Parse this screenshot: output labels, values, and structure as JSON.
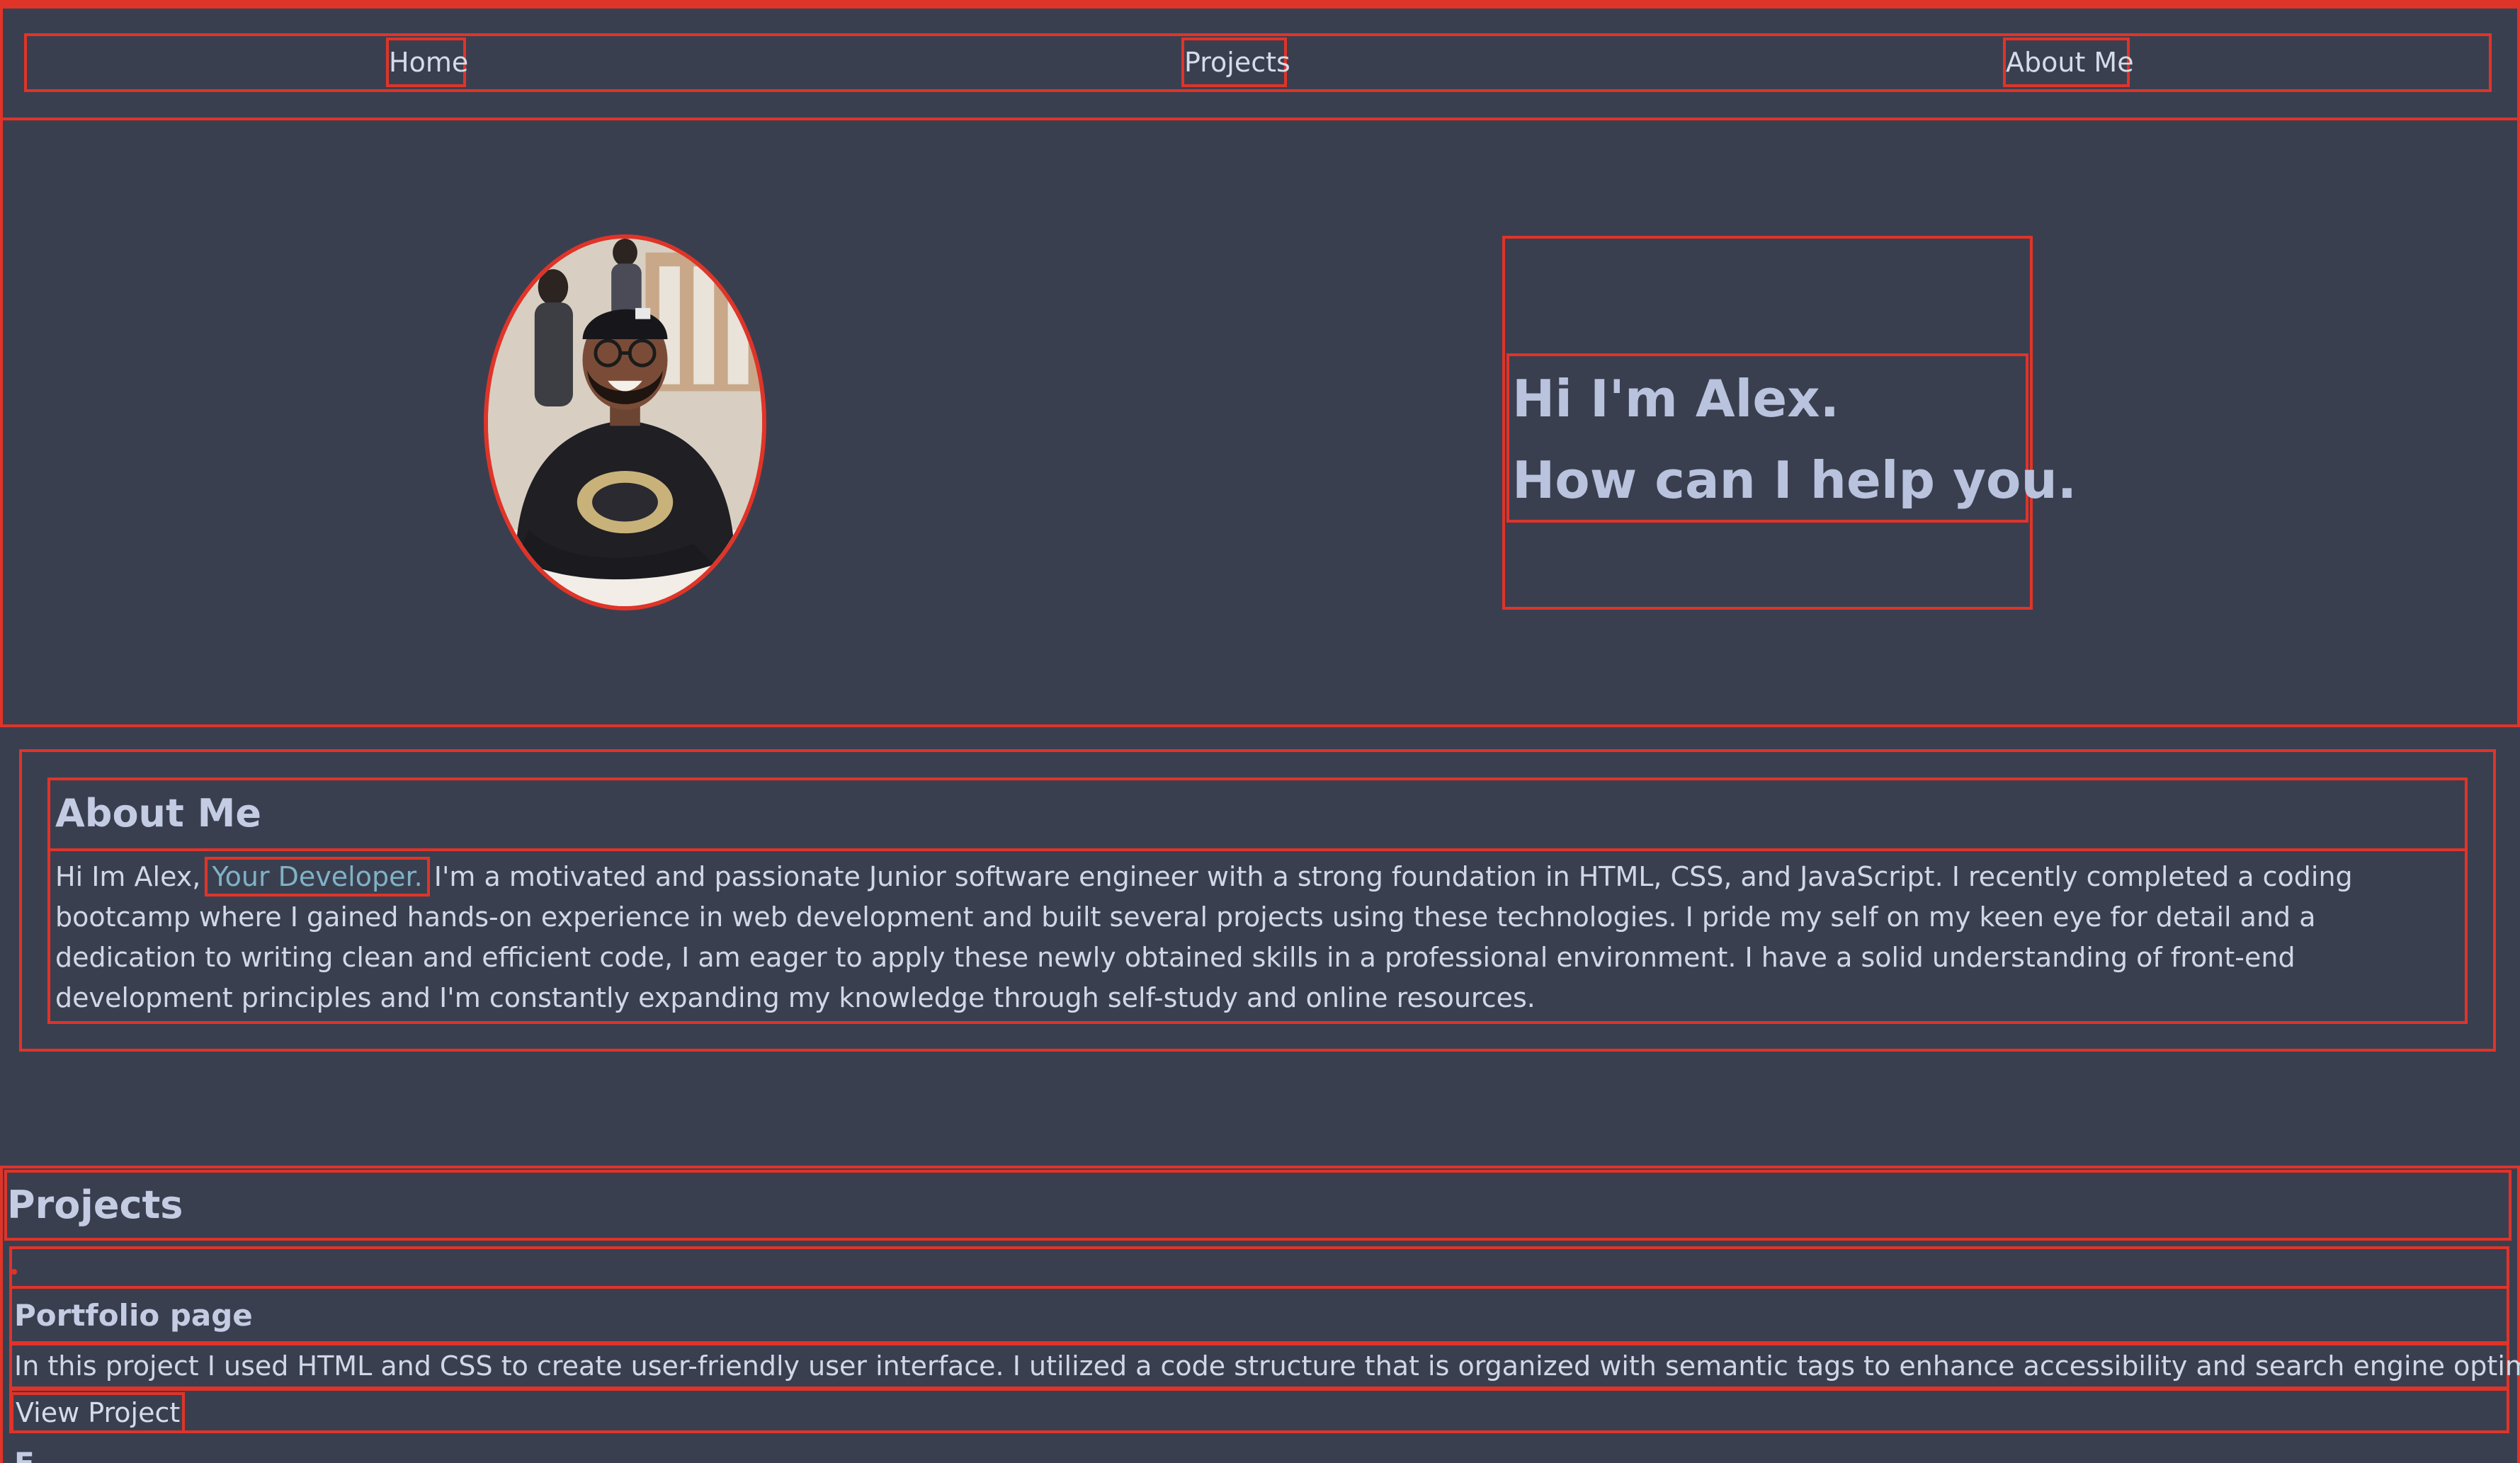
{
  "nav": {
    "items": [
      {
        "label": "Home"
      },
      {
        "label": "Projects"
      },
      {
        "label": "About Me"
      }
    ]
  },
  "hero": {
    "greeting": "Hi I'm Alex.",
    "tagline": "How can I help you.",
    "avatar_icon": "profile-photo"
  },
  "about": {
    "title": "About Me",
    "intro": "Hi Im Alex,",
    "link_label": "Your Developer.",
    "body": "I'm a motivated and passionate Junior software engineer with a strong foundation in HTML, CSS, and JavaScript. I recently completed a coding bootcamp where I gained hands-on experience in web development and built several projects using these technologies. I pride my self on my keen eye for detail and a dedication to writing clean and efficient code, I am eager to apply these newly obtained skills in a professional environment. I have a solid understanding of front-end development principles and I'm constantly expanding my knowledge through self-study and online resources."
  },
  "projects": {
    "title": "Projects",
    "items": [
      {
        "title": "Portfolio page",
        "description": "In this project I used HTML and CSS to create user-friendly user interface. I utilized a code structure that is organized with semantic tags to enhance accessibility and search engine optimization.",
        "link_label": "View Project"
      }
    ],
    "next_title_partial": "E"
  },
  "colors": {
    "background": "#3a3f50",
    "outline": "#e03428",
    "heading": "#c3cce3",
    "link": "#7fb2c6"
  }
}
